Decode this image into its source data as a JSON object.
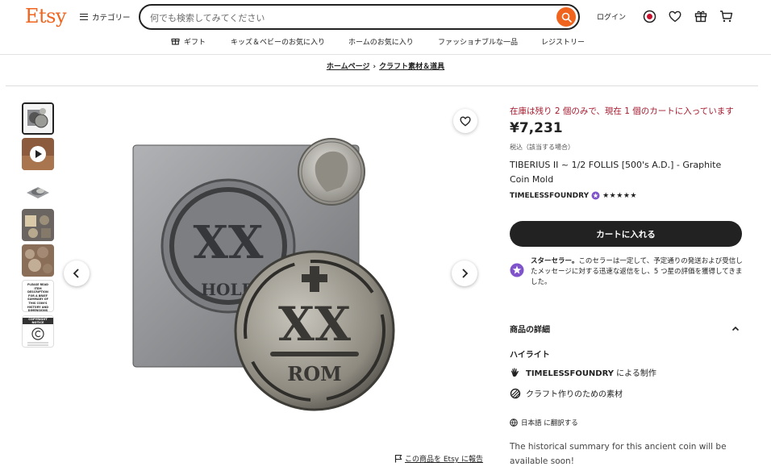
{
  "header": {
    "logo": "Etsy",
    "categories_label": "カテゴリー",
    "search_placeholder": "何でも検索してみてください",
    "login_label": "ログイン"
  },
  "nav": {
    "items": [
      "ギフト",
      "キッズ＆ベビーのお気に入り",
      "ホームのお気に入り",
      "ファッショナブルな一品",
      "レジストリー"
    ]
  },
  "breadcrumb": {
    "items": [
      "ホームページ",
      "クラフト素材＆道具"
    ],
    "separator": "›"
  },
  "gallery": {
    "thumb_text_1": "PLEASE READ ITEM DESCRIPTION FOR A BRIEF SUMMARY OF THIS COIN'S HISTORY AND DIMENSIONS",
    "thumb_text_2": "COPYRIGHT NOTICE",
    "main_mold_letters": "XX",
    "main_mold_sub": "HOLD",
    "main_coin_letters": "XX",
    "main_coin_sub": "ROM",
    "report_label": "この商品を Etsy に報告"
  },
  "product": {
    "stock_notice": "在庫は残り 2 個のみで、現在 1 個のカートに入っています",
    "price": "¥7,231",
    "tax_note": "税込（該当する場合）",
    "title": "TIBERIUS II ~ 1/2 FOLLIS [500's A.D.] - Graphite Coin Mold",
    "shop_name": "TIMELESSFOUNDRY",
    "stars": "★★★★★",
    "add_to_cart": "カートに入れる",
    "star_seller_title": "スターセラー。",
    "star_seller_text": "このセラーは一定して、予定通りの発送および受信したメッセージに対する迅速な返信をし、5 つ星の評価を獲得してきました。"
  },
  "details": {
    "heading": "商品の詳細",
    "highlight_heading": "ハイライト",
    "made_by_shop": "TIMELESSFOUNDRY",
    "made_by_suffix": " による制作",
    "craft_supply": "クラフト作りのための素材",
    "translate_label": "日本語 に翻訳する",
    "description": "The historical summary for this ancient coin will be available soon!"
  },
  "colors": {
    "brand": "#f1641e",
    "stock_red": "#a61a2e",
    "star_seller_purple": "#7f54ca"
  }
}
